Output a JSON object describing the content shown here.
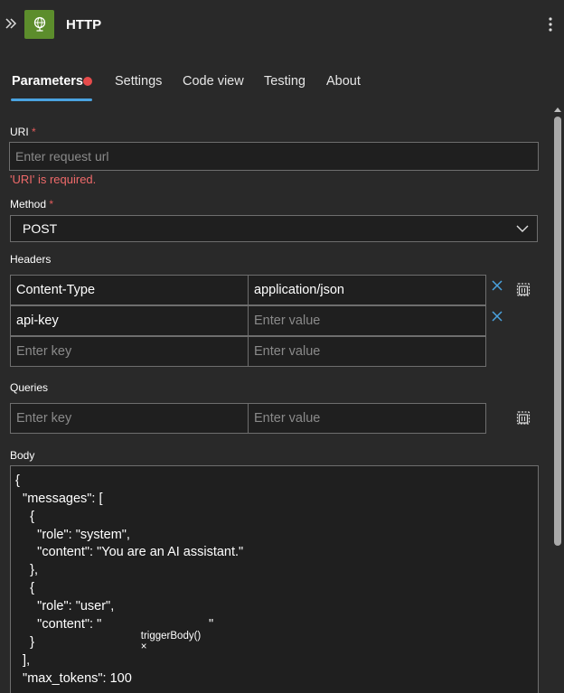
{
  "header": {
    "title": "HTTP",
    "icon": "globe-icon",
    "tile_color": "#5c8d2c"
  },
  "tabs": [
    {
      "label": "Parameters",
      "active": true
    },
    {
      "label": "Settings"
    },
    {
      "label": "Code view"
    },
    {
      "label": "Testing"
    },
    {
      "label": "About"
    }
  ],
  "uri": {
    "label": "URI",
    "required_mark": "*",
    "placeholder": "Enter request url",
    "error": "'URI' is required."
  },
  "method": {
    "label": "Method",
    "required_mark": "*",
    "value": "POST"
  },
  "headers": {
    "label": "Headers",
    "rows": [
      {
        "key": "Content-Type",
        "value": "application/json"
      },
      {
        "key": "api-key",
        "value_placeholder": "Enter value"
      },
      {
        "key_placeholder": "Enter key",
        "value_placeholder": "Enter value"
      }
    ]
  },
  "queries": {
    "label": "Queries",
    "key_placeholder": "Enter key",
    "value_placeholder": "Enter value"
  },
  "body": {
    "label": "Body",
    "lines": [
      "{",
      "  \"messages\": [",
      "    {",
      "      \"role\": \"system\",",
      "      \"content\": \"You are an AI assistant.\"",
      "    },",
      "    {",
      "      \"role\": \"user\",",
      "      \"content\": \"",
      "    }",
      "  ],",
      "  \"max_tokens\": 100"
    ],
    "token": {
      "label": "triggerBody()",
      "close": "×",
      "after": "\""
    }
  },
  "colors": {
    "error": "#ef6a6a",
    "accent": "#4aa3e0",
    "dot": "#e64b4b"
  }
}
